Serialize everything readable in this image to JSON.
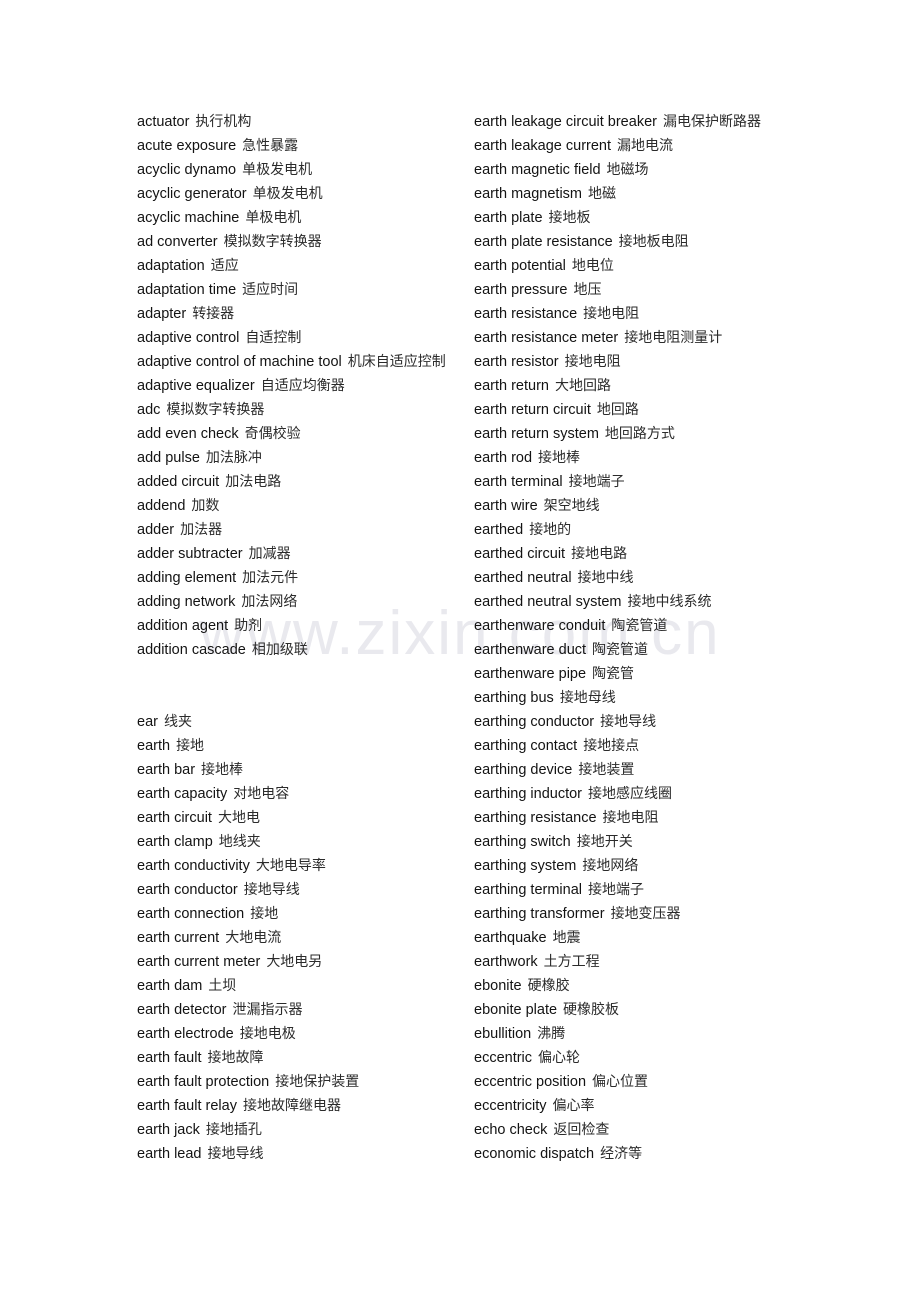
{
  "document": {
    "type": "bilingual-glossary",
    "watermark": "www.zixin.com.cn"
  },
  "columns": {
    "left": [
      {
        "term": "actuator",
        "gloss": "执行机构"
      },
      {
        "term": "acute exposure",
        "gloss": "急性暴露"
      },
      {
        "term": "acyclic dynamo",
        "gloss": "单极发电机"
      },
      {
        "term": "acyclic generator",
        "gloss": "单极发电机"
      },
      {
        "term": "acyclic machine",
        "gloss": "单极电机"
      },
      {
        "term": "ad converter",
        "gloss": "模拟数字转换器"
      },
      {
        "term": "adaptation",
        "gloss": "适应"
      },
      {
        "term": "adaptation time",
        "gloss": "适应时间"
      },
      {
        "term": "adapter",
        "gloss": "转接器"
      },
      {
        "term": "adaptive control",
        "gloss": "自适控制"
      },
      {
        "term": "adaptive control of machine tool",
        "gloss": "机床自适应控制"
      },
      {
        "term": "adaptive equalizer",
        "gloss": "自适应均衡器"
      },
      {
        "term": "adc",
        "gloss": "模拟数字转换器"
      },
      {
        "term": "add even check",
        "gloss": "奇偶校验"
      },
      {
        "term": "add pulse",
        "gloss": "加法脉冲"
      },
      {
        "term": "added circuit",
        "gloss": "加法电路"
      },
      {
        "term": "addend",
        "gloss": "加数"
      },
      {
        "term": "adder",
        "gloss": "加法器"
      },
      {
        "term": "adder subtracter",
        "gloss": "加减器"
      },
      {
        "term": "adding element",
        "gloss": "加法元件"
      },
      {
        "term": "adding network",
        "gloss": "加法网络"
      },
      {
        "term": "addition agent",
        "gloss": "助剂"
      },
      {
        "term": "addition cascade",
        "gloss": "相加级联"
      },
      {
        "term": "",
        "gloss": ""
      },
      {
        "term": "",
        "gloss": ""
      },
      {
        "term": "ear",
        "gloss": "线夹"
      },
      {
        "term": "earth",
        "gloss": "接地"
      },
      {
        "term": "earth bar",
        "gloss": "接地棒"
      },
      {
        "term": "earth capacity",
        "gloss": "对地电容"
      },
      {
        "term": "earth circuit",
        "gloss": "大地电"
      },
      {
        "term": "earth clamp",
        "gloss": "地线夹"
      },
      {
        "term": "earth conductivity",
        "gloss": "大地电导率"
      },
      {
        "term": "earth conductor",
        "gloss": "接地导线"
      },
      {
        "term": "earth connection",
        "gloss": "接地"
      },
      {
        "term": "earth current",
        "gloss": "大地电流"
      },
      {
        "term": "earth current meter",
        "gloss": "大地电另"
      },
      {
        "term": "earth dam",
        "gloss": "土坝"
      },
      {
        "term": "earth detector",
        "gloss": "泄漏指示器"
      },
      {
        "term": "earth electrode",
        "gloss": "接地电极"
      },
      {
        "term": "earth fault",
        "gloss": "接地故障"
      },
      {
        "term": "earth fault protection",
        "gloss": "接地保护装置"
      },
      {
        "term": "earth fault relay",
        "gloss": "接地故障继电器"
      },
      {
        "term": "earth jack",
        "gloss": "接地插孔"
      },
      {
        "term": "earth lead",
        "gloss": "接地导线"
      }
    ],
    "right": [
      {
        "term": "earth leakage circuit breaker",
        "gloss": "漏电保护断路器"
      },
      {
        "term": "earth leakage current",
        "gloss": "漏地电流"
      },
      {
        "term": "earth magnetic field",
        "gloss": "地磁场"
      },
      {
        "term": "earth magnetism",
        "gloss": "地磁"
      },
      {
        "term": "earth plate",
        "gloss": "接地板"
      },
      {
        "term": "earth plate resistance",
        "gloss": "接地板电阻"
      },
      {
        "term": "earth potential",
        "gloss": "地电位"
      },
      {
        "term": "earth pressure",
        "gloss": "地压"
      },
      {
        "term": "earth resistance",
        "gloss": "接地电阻"
      },
      {
        "term": "earth resistance meter",
        "gloss": "接地电阻测量计"
      },
      {
        "term": "earth resistor",
        "gloss": "接地电阻"
      },
      {
        "term": "earth return",
        "gloss": "大地回路"
      },
      {
        "term": "earth return circuit",
        "gloss": "地回路"
      },
      {
        "term": "earth return system",
        "gloss": "地回路方式"
      },
      {
        "term": "earth rod",
        "gloss": "接地棒"
      },
      {
        "term": "earth terminal",
        "gloss": "接地端子"
      },
      {
        "term": "earth wire",
        "gloss": "架空地线"
      },
      {
        "term": "earthed",
        "gloss": "接地的"
      },
      {
        "term": "earthed circuit",
        "gloss": "接地电路"
      },
      {
        "term": "earthed neutral",
        "gloss": "接地中线"
      },
      {
        "term": "earthed neutral system",
        "gloss": "接地中线系统"
      },
      {
        "term": "earthenware conduit",
        "gloss": "陶瓷管道"
      },
      {
        "term": "earthenware duct",
        "gloss": "陶瓷管道"
      },
      {
        "term": "earthenware pipe",
        "gloss": "陶瓷管"
      },
      {
        "term": "earthing bus",
        "gloss": "接地母线"
      },
      {
        "term": "earthing conductor",
        "gloss": "接地导线"
      },
      {
        "term": "earthing contact",
        "gloss": "接地接点"
      },
      {
        "term": "earthing device",
        "gloss": "接地装置"
      },
      {
        "term": "earthing inductor",
        "gloss": "接地感应线圈"
      },
      {
        "term": "earthing resistance",
        "gloss": "接地电阻"
      },
      {
        "term": "earthing switch",
        "gloss": "接地开关"
      },
      {
        "term": "earthing system",
        "gloss": "接地网络"
      },
      {
        "term": "earthing terminal",
        "gloss": "接地端子"
      },
      {
        "term": "earthing transformer",
        "gloss": "接地变压器"
      },
      {
        "term": "earthquake",
        "gloss": "地震"
      },
      {
        "term": "earthwork",
        "gloss": "土方工程"
      },
      {
        "term": "ebonite",
        "gloss": "硬橡胶"
      },
      {
        "term": "ebonite plate",
        "gloss": "硬橡胶板"
      },
      {
        "term": "ebullition",
        "gloss": "沸腾"
      },
      {
        "term": "eccentric",
        "gloss": "偏心轮"
      },
      {
        "term": "eccentric position",
        "gloss": "偏心位置"
      },
      {
        "term": "eccentricity",
        "gloss": "偏心率"
      },
      {
        "term": "echo check",
        "gloss": "返回检查"
      },
      {
        "term": "economic dispatch",
        "gloss": "经济等"
      }
    ]
  }
}
